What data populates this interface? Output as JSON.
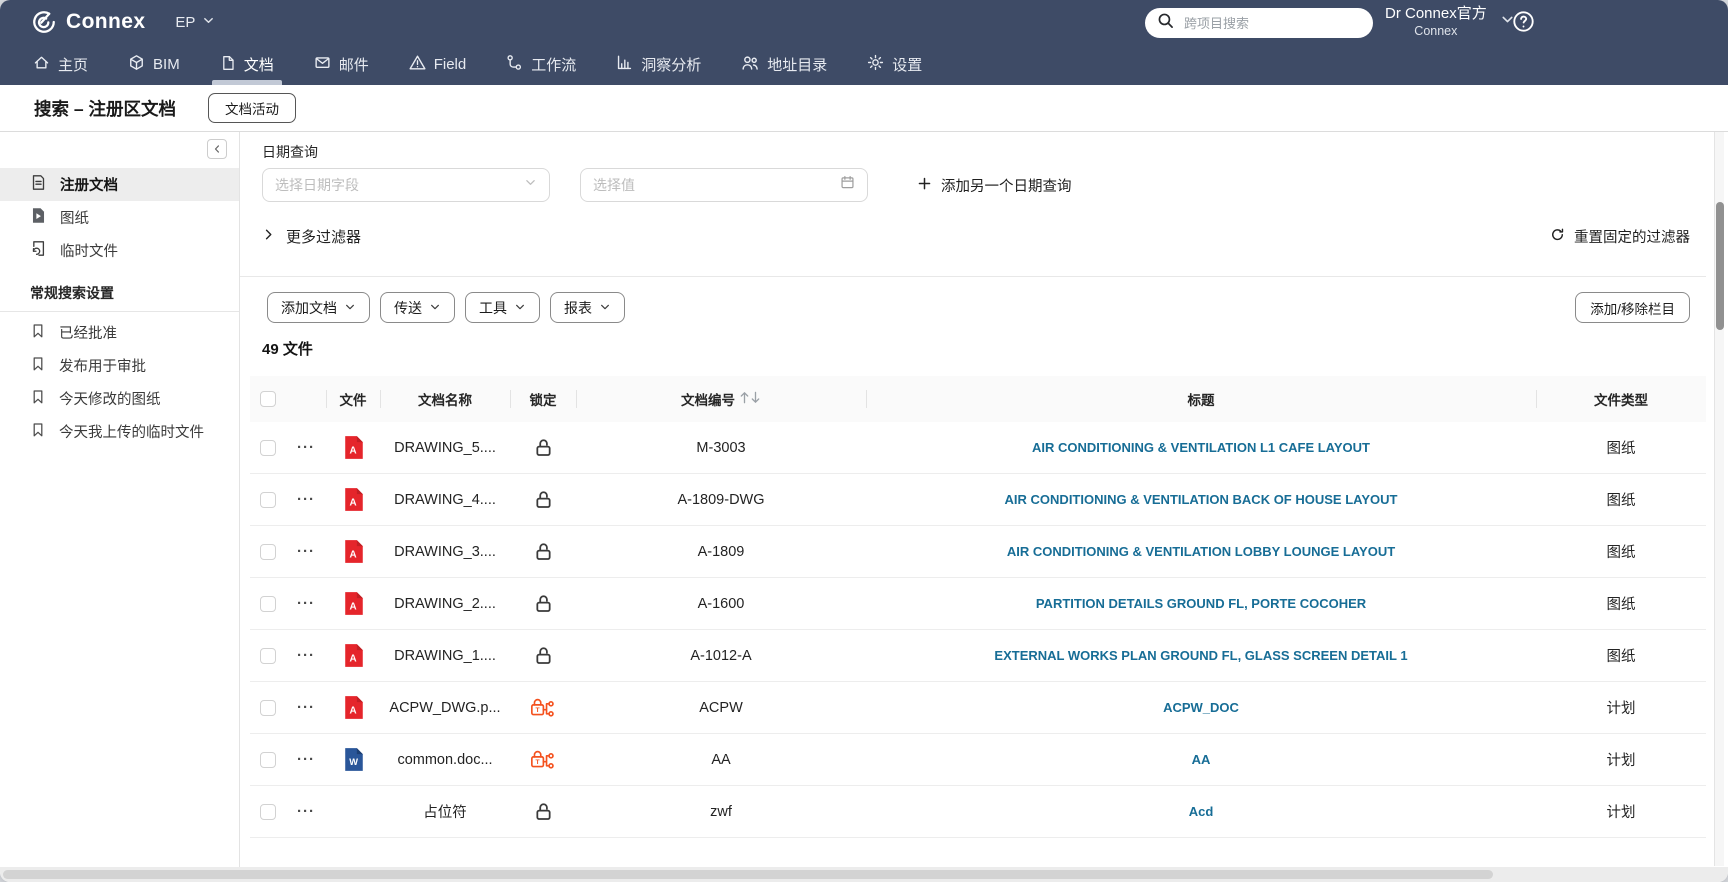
{
  "topbar": {
    "brand": "Connex",
    "project_switcher": "EP",
    "search_placeholder": "跨项目搜索",
    "user_name": "Dr Connex官方",
    "user_org": "Connex"
  },
  "nav": {
    "active": "文档",
    "items": [
      {
        "icon": "home",
        "label": "主页"
      },
      {
        "icon": "cube",
        "label": "BIM"
      },
      {
        "icon": "doc",
        "label": "文档"
      },
      {
        "icon": "mail",
        "label": "邮件"
      },
      {
        "icon": "warn",
        "label": "Field"
      },
      {
        "icon": "flow",
        "label": "工作流"
      },
      {
        "icon": "chart",
        "label": "洞察分析"
      },
      {
        "icon": "users",
        "label": "地址目录"
      },
      {
        "icon": "gear",
        "label": "设置"
      }
    ]
  },
  "page": {
    "title": "搜索 – 注册区文档",
    "activity_button": "文档活动"
  },
  "sidebar": {
    "items": [
      {
        "icon": "fileLines",
        "label": "注册文档",
        "active": true
      },
      {
        "icon": "pdfDark",
        "label": "图纸",
        "active": false
      },
      {
        "icon": "fileRefresh",
        "label": "临时文件",
        "active": false
      }
    ],
    "section": "常规搜索设置",
    "saved": [
      {
        "icon": "bookmark",
        "label": "已经批准"
      },
      {
        "icon": "bookmark",
        "label": "发布用于审批"
      },
      {
        "icon": "bookmark",
        "label": "今天修改的图纸"
      },
      {
        "icon": "bookmark",
        "label": "今天我上传的临时文件"
      }
    ]
  },
  "filters": {
    "date_group_label": "日期查询",
    "field_placeholder": "选择日期字段",
    "value_placeholder": "选择值",
    "add_another": "添加另一个日期查询",
    "more_filters": "更多过滤器",
    "reset_pinned": "重置固定的过滤器"
  },
  "toolbar": {
    "buttons": [
      "添加文档",
      "传送",
      "工具",
      "报表"
    ],
    "columns_button": "添加/移除栏目"
  },
  "results_count": "49 文件",
  "table": {
    "headers": {
      "file": "文件",
      "name": "文档名称",
      "lock": "锁定",
      "number": "文档编号",
      "title": "标题",
      "type": "文件类型"
    },
    "rows": [
      {
        "name": "DRAWING_5....",
        "file_icon": "pdf",
        "lock": "unlocked",
        "number": "M-3003",
        "title": "AIR CONDITIONING & VENTILATION L1 CAFE LAYOUT",
        "type": "图纸"
      },
      {
        "name": "DRAWING_4....",
        "file_icon": "pdf",
        "lock": "unlocked",
        "number": "A-1809-DWG",
        "title": "AIR CONDITIONING & VENTILATION BACK OF HOUSE LAYOUT",
        "type": "图纸"
      },
      {
        "name": "DRAWING_3....",
        "file_icon": "pdf",
        "lock": "unlocked",
        "number": "A-1809",
        "title": "AIR CONDITIONING & VENTILATION LOBBY LOUNGE LAYOUT",
        "type": "图纸"
      },
      {
        "name": "DRAWING_2....",
        "file_icon": "pdf",
        "lock": "unlocked",
        "number": "A-1600",
        "title": "PARTITION DETAILS GROUND FL, PORTE COCOHER",
        "type": "图纸"
      },
      {
        "name": "DRAWING_1....",
        "file_icon": "pdf",
        "lock": "unlocked",
        "number": "A-1012-A",
        "title": "EXTERNAL WORKS PLAN GROUND FL, GLASS SCREEN DETAIL 1",
        "type": "图纸"
      },
      {
        "name": "ACPW_DWG.p...",
        "file_icon": "pdf",
        "lock": "workflow",
        "number": "ACPW",
        "title": "ACPW_DOC",
        "type": "计划"
      },
      {
        "name": "common.doc...",
        "file_icon": "word",
        "lock": "workflow",
        "number": "AA",
        "title": "AA",
        "type": "计划"
      },
      {
        "name": "占位符",
        "file_icon": "none",
        "lock": "unlocked",
        "number": "zwf",
        "title": "Acd",
        "type": "计划"
      }
    ]
  },
  "colors": {
    "header_bg": "#3e4b66",
    "title_link": "#176d96",
    "workflow_lock_orange": "#f4511e",
    "pdf_red": "#e5252b",
    "word_blue": "#2a5699"
  }
}
